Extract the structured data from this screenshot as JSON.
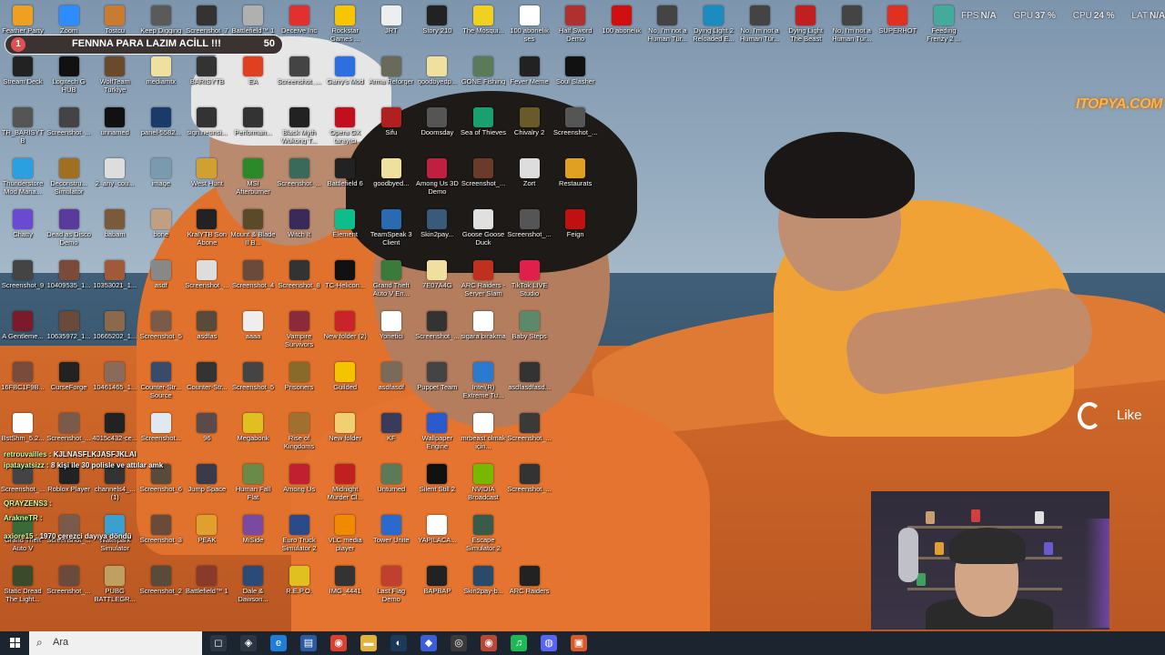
{
  "stream_overlay": {
    "donation_goal": {
      "badge": "1",
      "title": "FENNNA PARA LAZIM ACİLL !!!",
      "amount": "50"
    },
    "brand": "ITOPYA.COM",
    "like_label": "Like",
    "stats": [
      {
        "label": "FPS",
        "value": "N/A"
      },
      {
        "label": "GPU",
        "value": "37 %"
      },
      {
        "label": "CPU",
        "value": "24 %"
      },
      {
        "label": "LAT",
        "value": "N/A"
      }
    ],
    "chat": [
      {
        "user": "retrouvailles :",
        "text": "KJLNASFLKJASFJKLAI"
      },
      {
        "user": "ipatayatsizz :",
        "text": "8 kişi ile 30 polisle ve attılar amk"
      },
      {
        "user": "QRAYZENS3 :",
        "text": ""
      },
      {
        "user": "ArakneTR :",
        "text": ""
      },
      {
        "user": "axiore15 :",
        "text": "1970 çerezci dayıya döndü"
      }
    ]
  },
  "taskbar": {
    "search_placeholder": "Ara",
    "apps": [
      {
        "icon": "task-view-icon",
        "color": "#2b3645",
        "glyph": "◻"
      },
      {
        "icon": "copilot-icon",
        "color": "#2b3645",
        "glyph": "◈"
      },
      {
        "icon": "edge-icon",
        "color": "#1f7fd6",
        "glyph": "e"
      },
      {
        "icon": "files-icon",
        "color": "#2c5aa0",
        "glyph": "▤"
      },
      {
        "icon": "chrome-icon",
        "color": "#d9412f",
        "glyph": "◉"
      },
      {
        "icon": "explorer-icon",
        "color": "#e1b33c",
        "glyph": "▬"
      },
      {
        "icon": "steam-icon",
        "color": "#1b3a5a",
        "glyph": "◐"
      },
      {
        "icon": "app-icon",
        "color": "#3a5fd6",
        "glyph": "◆"
      },
      {
        "icon": "obs-icon",
        "color": "#3a3a3a",
        "glyph": "◎"
      },
      {
        "icon": "chrome-icon-2",
        "color": "#b94735",
        "glyph": "◉"
      },
      {
        "icon": "spotify-icon",
        "color": "#1db954",
        "glyph": "♫"
      },
      {
        "icon": "discord-icon",
        "color": "#5865f2",
        "glyph": "◍"
      },
      {
        "icon": "photo-icon",
        "color": "#d65a2a",
        "glyph": "▣"
      }
    ]
  },
  "desktop": {
    "icons": [
      {
        "label": "Feather Party",
        "color": "#f0a020"
      },
      {
        "label": "Zoom",
        "color": "#2d8cff"
      },
      {
        "label": "Tostcu",
        "color": "#c97b2f"
      },
      {
        "label": "Keep Digging",
        "color": "#5a5a5a"
      },
      {
        "label": "Screenshot_7",
        "color": "#333"
      },
      {
        "label": "Battlefield™ 1",
        "color": "#b0b0b0"
      },
      {
        "label": "Deceive Inc",
        "color": "#e03030"
      },
      {
        "label": "Rockstar Games ...",
        "color": "#f7c600"
      },
      {
        "label": "JRT",
        "color": "#eee"
      },
      {
        "label": "Story 210",
        "color": "#222"
      },
      {
        "label": "The Mosqui...",
        "color": "#f0d020"
      },
      {
        "label": "100 abonelik ses",
        "color": "#fff"
      },
      {
        "label": "Half Sword Demo",
        "color": "#b03030"
      },
      {
        "label": "100 abonelik",
        "color": "#d01010"
      },
      {
        "label": "No, I'm not a Human Tür...",
        "color": "#444"
      },
      {
        "label": "Dying Light 2 Reloaded E...",
        "color": "#1a8cc0"
      },
      {
        "label": "No, I'm not a Human Tür...",
        "color": "#444"
      },
      {
        "label": "Dying Light The Beast",
        "color": "#c02020"
      },
      {
        "label": "No, I'm not a Human Tür...",
        "color": "#444"
      },
      {
        "label": "SUPERHOT",
        "color": "#e03020"
      },
      {
        "label": "Feeding Frenzy 2 ...",
        "color": "#4a9"
      },
      {
        "label": "Stream Deck",
        "color": "#222"
      },
      {
        "label": "Logitech G HUB",
        "color": "#111"
      },
      {
        "label": "WolfTeam Turkiye",
        "color": "#6a4a2a"
      },
      {
        "label": "mediamtx",
        "color": "#f0e0a0"
      },
      {
        "label": "BARISYTB",
        "color": "#333"
      },
      {
        "label": "EA",
        "color": "#e04020"
      },
      {
        "label": "Screenshot_...",
        "color": "#444"
      },
      {
        "label": "Garry's Mod",
        "color": "#2d6fe0"
      },
      {
        "label": "Arma Reforger",
        "color": "#6a6a5a"
      },
      {
        "label": "goodbyedp...",
        "color": "#f0e0a0"
      },
      {
        "label": "GONE Fishing",
        "color": "#5a7a5a"
      },
      {
        "label": "Fever Meme",
        "color": "#222"
      },
      {
        "label": "Soul Slasher",
        "color": "#111"
      },
      {
        "label": "TR_BARISYTB",
        "color": "#555"
      },
      {
        "label": "Screenshot_...",
        "color": "#444"
      },
      {
        "label": "unnamed",
        "color": "#111"
      },
      {
        "label": "panel-5582...",
        "color": "#1a3a6a"
      },
      {
        "label": "sign.neonsi...",
        "color": "#333"
      },
      {
        "label": "Performan...",
        "color": "#333"
      },
      {
        "label": "Black Myth Wukong T...",
        "color": "#222"
      },
      {
        "label": "Opera GX tarayıcı",
        "color": "#c01020"
      },
      {
        "label": "Sifu",
        "color": "#b02020"
      },
      {
        "label": "Doomsday",
        "color": "#555"
      },
      {
        "label": "Sea of Thieves",
        "color": "#1aa070"
      },
      {
        "label": "Chivalry 2",
        "color": "#6a5a2a"
      },
      {
        "label": "Screenshot_...",
        "color": "#555"
      },
      {
        "label": "Thunderstore Mod Mana...",
        "color": "#2aa0e0"
      },
      {
        "label": "Deconstru... Simulator",
        "color": "#a07020"
      },
      {
        "label": "2_any_cou...",
        "color": "#ddd"
      },
      {
        "label": "image",
        "color": "#7a9ab0"
      },
      {
        "label": "West Hunt",
        "color": "#d0a030"
      },
      {
        "label": "MSI Afterburner",
        "color": "#2a8a2a"
      },
      {
        "label": "Screenshot_...",
        "color": "#3a6a5a"
      },
      {
        "label": "Battlefield 6",
        "color": "#222"
      },
      {
        "label": "goodbyed...",
        "color": "#f0e0a0"
      },
      {
        "label": "Among Us 3D Demo",
        "color": "#c02040"
      },
      {
        "label": "Screenshot_...",
        "color": "#6a3a2a"
      },
      {
        "label": "Zort",
        "color": "#ddd"
      },
      {
        "label": "Restaurats",
        "color": "#e0a020"
      },
      {
        "label": "Chatty",
        "color": "#6a4ad0"
      },
      {
        "label": "Dead as Disco Demo",
        "color": "#5a3a9a"
      },
      {
        "label": "babam",
        "color": "#7a5a3a"
      },
      {
        "label": "bone",
        "color": "#c0a080"
      },
      {
        "label": "KralYTB Son Abone",
        "color": "#222"
      },
      {
        "label": "Mount & Blade II B...",
        "color": "#5a4a2a"
      },
      {
        "label": "Witch It",
        "color": "#3a2a5a"
      },
      {
        "label": "Element",
        "color": "#0dbd8b"
      },
      {
        "label": "TeamSpeak 3 Client",
        "color": "#2a6ab0"
      },
      {
        "label": "Skin2pay...",
        "color": "#3a5a7a"
      },
      {
        "label": "Goose Goose Duck",
        "color": "#e0e0e0"
      },
      {
        "label": "Screenshot_...",
        "color": "#555"
      },
      {
        "label": "Feign",
        "color": "#c01010"
      },
      {
        "label": "Screenshot_9",
        "color": "#444"
      },
      {
        "label": "10409535_1...",
        "color": "#7a4a3a"
      },
      {
        "label": "10353021_1...",
        "color": "#a05a3a"
      },
      {
        "label": "asdf",
        "color": "#888"
      },
      {
        "label": "Screenshot_...",
        "color": "#ddd"
      },
      {
        "label": "Screenshot_4",
        "color": "#6a4a3a"
      },
      {
        "label": "Screenshot_8",
        "color": "#333"
      },
      {
        "label": "TC-Helicon...",
        "color": "#111"
      },
      {
        "label": "Grand Theft Auto V En...",
        "color": "#3a7a3a"
      },
      {
        "label": "7E07A4G",
        "color": "#f0e0a0"
      },
      {
        "label": "ARC Raiders - Server Slam",
        "color": "#c03020"
      },
      {
        "label": "TikTok LIVE Studio",
        "color": "#e0204a"
      },
      {
        "label": "A Gentleme...",
        "color": "#7a1a2a"
      },
      {
        "label": "10635972_1...",
        "color": "#6a4a3a"
      },
      {
        "label": "10665202_1...",
        "color": "#8a6a4a"
      },
      {
        "label": "Screenshot_5",
        "color": "#7a5a4a"
      },
      {
        "label": "asdfas",
        "color": "#5a4a3a"
      },
      {
        "label": "aaaa",
        "color": "#eee"
      },
      {
        "label": "Vampire Survivors",
        "color": "#8a2a3a"
      },
      {
        "label": "New folder (2)",
        "color": "#c8242a"
      },
      {
        "label": "Yonetici",
        "color": "#fff"
      },
      {
        "label": "Screenshot_...",
        "color": "#333"
      },
      {
        "label": "sigara bırakma",
        "color": "#fff"
      },
      {
        "label": "Baby Steps",
        "color": "#5a8a6a"
      },
      {
        "label": "16FBC1F9B...",
        "color": "#7a4a3a"
      },
      {
        "label": "CurseForge",
        "color": "#222"
      },
      {
        "label": "10461465_1...",
        "color": "#8a6a5a"
      },
      {
        "label": "Counter-Str... Source",
        "color": "#3a4a6a"
      },
      {
        "label": "Counter-Str...",
        "color": "#333"
      },
      {
        "label": "Screenshot_5",
        "color": "#444"
      },
      {
        "label": "Prisoners",
        "color": "#8a6a2a"
      },
      {
        "label": "Guilded",
        "color": "#f5c400"
      },
      {
        "label": "asdfasdf",
        "color": "#7a6a5a"
      },
      {
        "label": "Puppet Team",
        "color": "#444"
      },
      {
        "label": "Intel(R) Extreme Tu...",
        "color": "#2a7ad0"
      },
      {
        "label": "asdfasdfasd...",
        "color": "#333"
      },
      {
        "label": "BstShm_5.2...",
        "color": "#fff"
      },
      {
        "label": "Screenshot_...",
        "color": "#7a5a4a"
      },
      {
        "label": "4015c432-ce...",
        "color": "#222"
      },
      {
        "label": "Screenshot...",
        "color": "#e0e8f0"
      },
      {
        "label": "96",
        "color": "#5a4a4a"
      },
      {
        "label": "Megabonk",
        "color": "#e0c020"
      },
      {
        "label": "Rise of Kingdoms",
        "color": "#a07030"
      },
      {
        "label": "New folder",
        "color": "#f0d070"
      },
      {
        "label": "KF",
        "color": "#3a3a5a"
      },
      {
        "label": "Wallpaper Engine",
        "color": "#2a5ad0"
      },
      {
        "label": "mrbeast olmak için...",
        "color": "#fff"
      },
      {
        "label": "Screenshot_...",
        "color": "#3a3a3a"
      },
      {
        "label": "Screenshot_...",
        "color": "#444"
      },
      {
        "label": "Roblox Player",
        "color": "#222"
      },
      {
        "label": "channels4_... (1)",
        "color": "#333"
      },
      {
        "label": "Screenshot_6",
        "color": "#5a4a3a"
      },
      {
        "label": "Jump Space",
        "color": "#3a3a4a"
      },
      {
        "label": "Human Fall Flat",
        "color": "#6a8a4a"
      },
      {
        "label": "Among Us",
        "color": "#c02030"
      },
      {
        "label": "Midnight Murder Cl...",
        "color": "#c02020"
      },
      {
        "label": "Unturned",
        "color": "#5a7a5a"
      },
      {
        "label": "Silent Still 2",
        "color": "#111"
      },
      {
        "label": "NVIDIA Broadcast",
        "color": "#76b900"
      },
      {
        "label": "Screenshot_...",
        "color": "#333"
      },
      {
        "label": "Grand Theft Auto V",
        "color": "#3a6a3a"
      },
      {
        "label": "Screenshot_...",
        "color": "#7a5a4a"
      },
      {
        "label": "Waterpark Simulator",
        "color": "#3aa0d0"
      },
      {
        "label": "Screenshot_3",
        "color": "#6a4a3a"
      },
      {
        "label": "PEAK",
        "color": "#e0a030"
      },
      {
        "label": "MiSide",
        "color": "#7a4aa0"
      },
      {
        "label": "Euro Truck Simulator 2",
        "color": "#2a4a8a"
      },
      {
        "label": "VLC media player",
        "color": "#f08a00"
      },
      {
        "label": "Tower Unite",
        "color": "#2a6ad0"
      },
      {
        "label": "YAPILACA...",
        "color": "#fff"
      },
      {
        "label": "Escape Simulator 2",
        "color": "#3a5a4a"
      },
      {
        "label": "Static Dread The Light...",
        "color": "#3a4a2a"
      },
      {
        "label": "Screenshot_...",
        "color": "#6a4a3a"
      },
      {
        "label": "PUBG BATTLEGR...",
        "color": "#c0a060"
      },
      {
        "label": "Screenshot_2",
        "color": "#5a4a3a"
      },
      {
        "label": "Battlefield™ 1",
        "color": "#8a3a2a"
      },
      {
        "label": "Dale & Dawson...",
        "color": "#2a4a7a"
      },
      {
        "label": "R.E.P.O.",
        "color": "#e0c020"
      },
      {
        "label": "IMG_4441",
        "color": "#333"
      },
      {
        "label": "Last Flag Demo",
        "color": "#c04030"
      },
      {
        "label": "BAPBAP",
        "color": "#222"
      },
      {
        "label": "Skin2pay-b...",
        "color": "#2a4a6a"
      },
      {
        "label": "ARC Raiders",
        "color": "#222"
      }
    ]
  },
  "webcam": {
    "light_color": "#aa5aff"
  }
}
